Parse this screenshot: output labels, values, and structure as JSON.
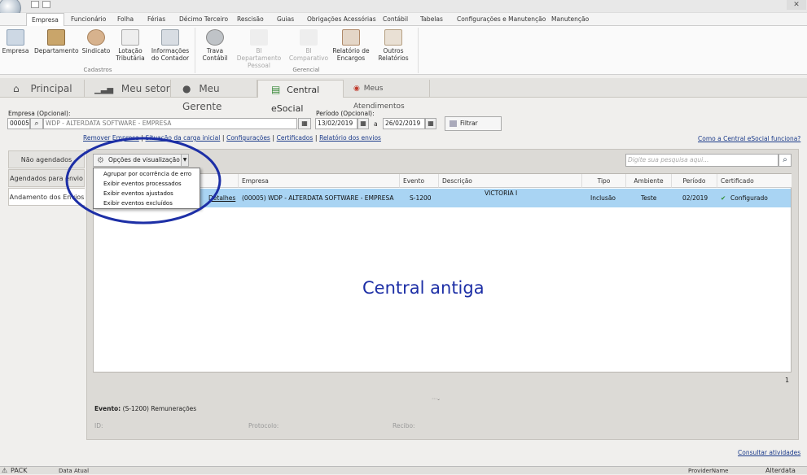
{
  "menu_tabs": [
    "Empresa",
    "Funcionário",
    "Folha",
    "Férias",
    "Décimo Terceiro",
    "Rescisão",
    "Guias",
    "Obrigações Acessórias",
    "Contábil",
    "Tabelas",
    "Configurações e Manutenção",
    "Manutenção"
  ],
  "ribbon": {
    "cadastros": [
      "Empresa",
      "Departamento",
      "Sindicato",
      "Lotação Tributária",
      "Informações do Contador"
    ],
    "gerencial": [
      "Trava Contábil",
      "BI Departamento Pessoal",
      "BI Comparativo",
      "Relatório de Encargos",
      "Outros Relatórios"
    ],
    "group_cadastros": "Cadastros",
    "group_gerencial": "Gerencial"
  },
  "nav_tabs": [
    "Principal",
    "Meu setor",
    "Meu Gerente",
    "Central eSocial",
    "Meus Atendimentos"
  ],
  "filters": {
    "empresa_label": "Empresa (Opcional):",
    "empresa_code": "00005",
    "empresa_name": "WDP - ALTERDATA SOFTWARE - EMPRESA",
    "periodo_label": "Período (Opcional):",
    "date_from": "13/02/2019",
    "date_sep": "a",
    "date_to": "26/02/2019",
    "filter_button": "Filtrar"
  },
  "links": [
    "Remover Empresa",
    "Situação da carga inicial",
    "Configurações",
    "Certificados",
    "Relatório dos envios"
  ],
  "help_link": "Como a Central eSocial funciona?",
  "side_tabs": [
    "Não agendados",
    "Agendados para envio",
    "Andamento dos Envios"
  ],
  "view_options_button": "Opções de visualização",
  "search_placeholder": "Digite sua pesquisa aqui...",
  "dropdown_items": [
    "Agrupar por ocorrência de erro",
    "Exibir eventos processados",
    "Exibir eventos ajustados",
    "Exibir eventos excluídos"
  ],
  "grid": {
    "headers": [
      "Empresa",
      "Evento",
      "Descrição",
      "Tipo",
      "Ambiente",
      "Período",
      "Certificado"
    ],
    "row": {
      "details": "Detalhes",
      "empresa": "(00005) WDP - ALTERDATA SOFTWARE - EMPRESA",
      "evento": "S-1200",
      "descricao": "VICTORIA I",
      "tipo": "Inclusão",
      "ambiente": "Teste",
      "periodo": "02/2019",
      "certificado": "Configurado"
    },
    "page": "1"
  },
  "watermark": "Central antiga",
  "event_label": "Evento:",
  "event_value": "(S-1200) Remunerações",
  "id_label": "ID:",
  "protocolo_label": "Protocolo:",
  "recibo_label": "Recibo:",
  "consultar_link": "Consultar atividades",
  "statusbar": [
    "PACK",
    "Data Atual",
    "ProviderName",
    "Alterdata"
  ],
  "colors": {
    "accent_row": "#a9d4f3",
    "annotation": "#1d2fa6"
  }
}
